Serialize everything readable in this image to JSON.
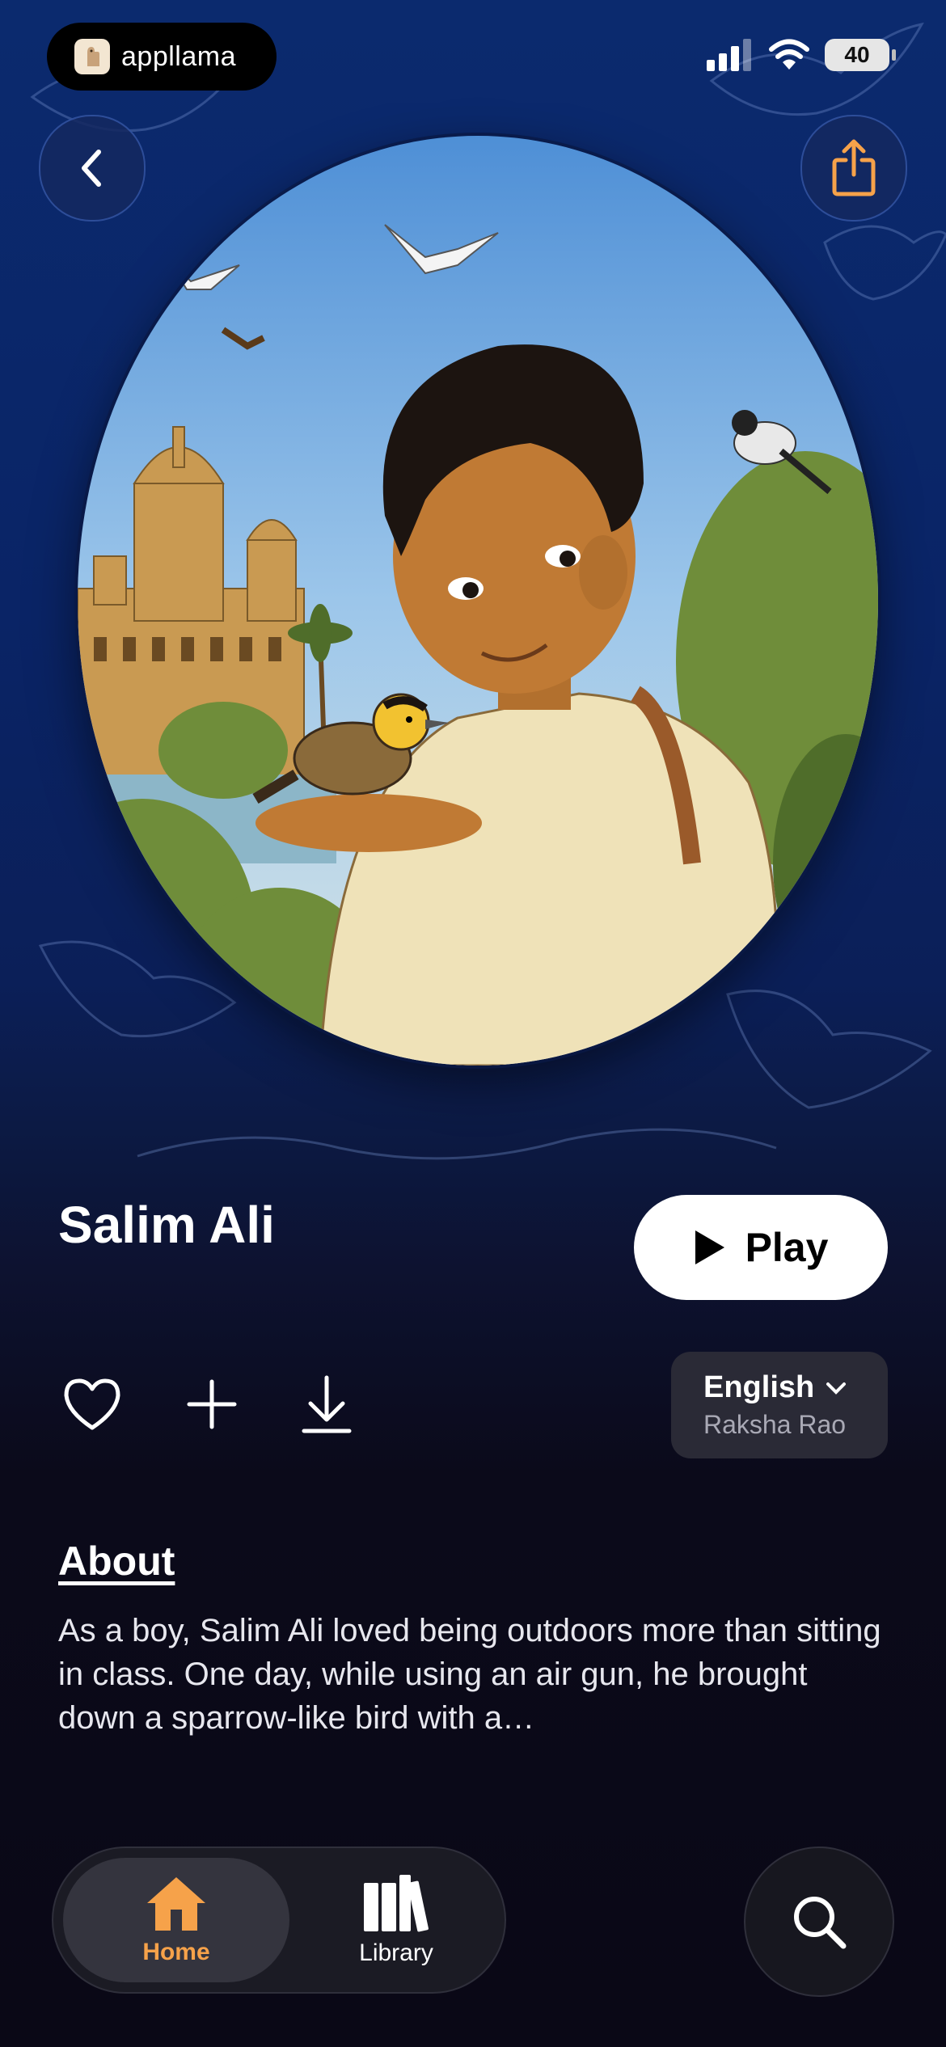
{
  "status_bar": {
    "brand": "appllama",
    "battery": "40"
  },
  "story": {
    "title": "Salim Ali",
    "play_label": "Play",
    "language": "English",
    "narrator": "Raksha Rao",
    "about_heading": "About",
    "about_text": "As a boy, Salim Ali loved being outdoors more than sitting in class. One day, while using an air gun, he brought down a sparrow-like bird with a…"
  },
  "tabs": [
    {
      "label": "Home",
      "icon": "house-icon",
      "active": true
    },
    {
      "label": "Library",
      "icon": "books-icon",
      "active": false
    }
  ],
  "colors": {
    "accent": "#f6a24a",
    "background_top": "#0b2a6e",
    "background_bottom": "#0a0816"
  }
}
